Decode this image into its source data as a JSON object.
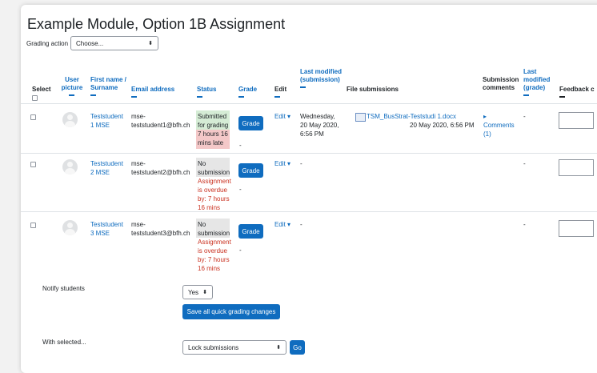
{
  "page": {
    "title": "Example Module, Option 1B Assignment"
  },
  "grading_action": {
    "label": "Grading action",
    "value": "Choose..."
  },
  "columns": {
    "select": "Select",
    "user_picture": "User picture",
    "name": "First name / Surname",
    "email": "Email address",
    "status": "Status",
    "grade": "Grade",
    "edit": "Edit",
    "last_modified_submission": "Last modified (submission)",
    "file_submissions": "File submissions",
    "submission_comments": "Submission comments",
    "last_modified_grade": "Last modified (grade)",
    "feedback": "Feedback c"
  },
  "rows": [
    {
      "first": "Teststudent",
      "last": "1 MSE",
      "email1": "mse-",
      "email2": "teststudent1@bfh.ch",
      "status": [
        "Submitted",
        "for grading"
      ],
      "status_late": [
        "7 hours 16",
        "mins late"
      ],
      "grade_button": "Grade",
      "grade_value": "-",
      "edit": "Edit",
      "modified": [
        "Wednesday,",
        "20 May 2020,",
        "6:56 PM"
      ],
      "file_name": "TSM_BusStrat-Teststudi 1.docx",
      "file_date": "20 May 2020, 6:56 PM",
      "comments_label": "Comments",
      "comments_count": "(1)",
      "grade_modified": "-"
    },
    {
      "first": "Teststudent",
      "last": "2 MSE",
      "email1": "mse-",
      "email2": "teststudent2@bfh.ch",
      "status": [
        "No",
        "submission"
      ],
      "status_overdue": [
        "Assignment",
        "is overdue",
        "by: 7 hours",
        "16 mins"
      ],
      "grade_button": "Grade",
      "grade_value": "-",
      "edit": "Edit",
      "modified": "-",
      "grade_modified": "-"
    },
    {
      "first": "Teststudent",
      "last": "3 MSE",
      "email1": "mse-",
      "email2": "teststudent3@bfh.ch",
      "status": [
        "No",
        "submission"
      ],
      "status_overdue": [
        "Assignment",
        "is overdue",
        "by: 7 hours",
        "16 mins"
      ],
      "grade_button": "Grade",
      "grade_value": "-",
      "edit": "Edit",
      "modified": "-",
      "grade_modified": "-"
    }
  ],
  "notify": {
    "label": "Notify students",
    "value": "Yes"
  },
  "save_button": "Save all quick grading changes",
  "with_selected": {
    "label": "With selected...",
    "value": "Lock submissions",
    "go": "Go"
  },
  "colors": {
    "link": "#0f6cbf",
    "submitted": "#d5ecd5",
    "late": "#f4c8c8",
    "overdue_text": "#ca3120",
    "no_submission": "#e6e6e6"
  }
}
